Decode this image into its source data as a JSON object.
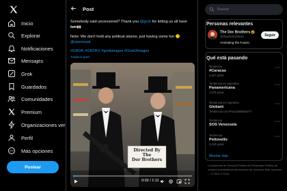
{
  "nav": {
    "items": [
      {
        "label": "Inicio",
        "icon": "home-icon"
      },
      {
        "label": "Explorar",
        "icon": "search-icon"
      },
      {
        "label": "Notificaciones",
        "icon": "bell-icon"
      },
      {
        "label": "Mensajes",
        "icon": "mail-icon"
      },
      {
        "label": "Grok",
        "icon": "grok-icon"
      },
      {
        "label": "Guardados",
        "icon": "bookmark-icon"
      },
      {
        "label": "Comunidades",
        "icon": "people-icon"
      },
      {
        "label": "Premium",
        "icon": "x-icon"
      },
      {
        "label": "Organizaciones veri",
        "icon": "lightning-icon"
      },
      {
        "label": "Perfil",
        "icon": "person-icon"
      },
      {
        "label": "Más opciones",
        "icon": "more-circle-icon"
      }
    ],
    "post_label": "Postear"
  },
  "main": {
    "title": "Post",
    "line1_a": "Somebody said uncensored? Thank you ",
    "line1_mention": "@grok",
    "line1_b": " for letting us all have some",
    "line2": "fun 🙌🏻",
    "line3": "Note: We don't hold any political stance, just having some fun 😊",
    "line4_mention": "@elonmusk",
    "hashtags": "#GROK #GROK2 #grokimages #Grok2images",
    "translate": "Traducir post",
    "media": {
      "sign_line1": "Directed By",
      "sign_line2": "The",
      "sign_line3": "Dor Brothers",
      "time": "0:02 / 1:11",
      "progress": 0.03
    }
  },
  "right": {
    "search_placeholder": "Buscar",
    "relevant": {
      "title": "Personas relevantes",
      "name": "The Dor Brothers",
      "handle": "@thedorbrothers",
      "bio": "Animating the Future.",
      "follow": "Seguir"
    },
    "trends_title": "Qué está pasando",
    "trends": [
      {
        "ctx": "Tendencia",
        "name": "#Caracas",
        "count": "4.507 posts"
      },
      {
        "ctx": "Tendencia en Argentina",
        "name": "Panamericana",
        "count": "1.676 posts"
      },
      {
        "ctx": "Tendencia en Argentina",
        "name": "Globant",
        "count": "Tendencia con #FuerzaMileiEnFT"
      },
      {
        "ctx": "Tendencia",
        "name": "SOS Venezuela",
        "count": "2.211 posts"
      },
      {
        "ctx": "Tendencia",
        "name": "Pettovello",
        "count": "3.229 posts"
      }
    ],
    "show_more": "Mostrar más",
    "footer": "Condiciones de Servicio   Política de Privacidad   Política de cookies   Accesibilidad   Información de anuncios   Más opciones ...   © 2024 X Corp."
  }
}
